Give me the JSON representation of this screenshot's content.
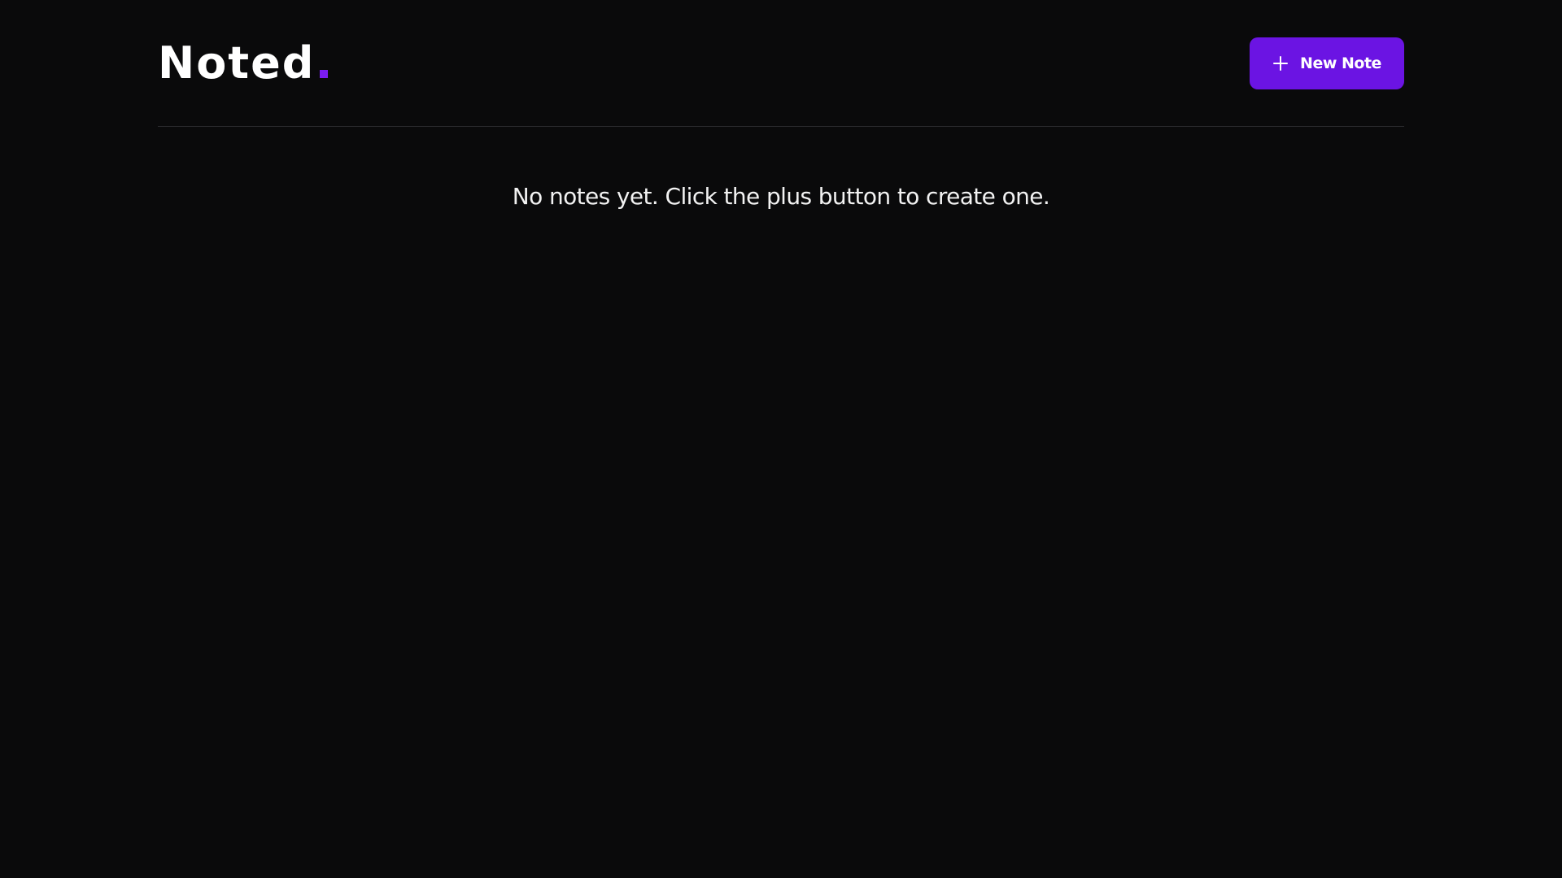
{
  "app": {
    "logo_text": "Noted",
    "accent_color": "#6b14e3",
    "background_color": "#0a0a0b"
  },
  "header": {
    "new_note_label": "New Note",
    "new_note_icon": "plus-icon"
  },
  "main": {
    "empty_message": "No notes yet. Click the plus button to create one."
  }
}
